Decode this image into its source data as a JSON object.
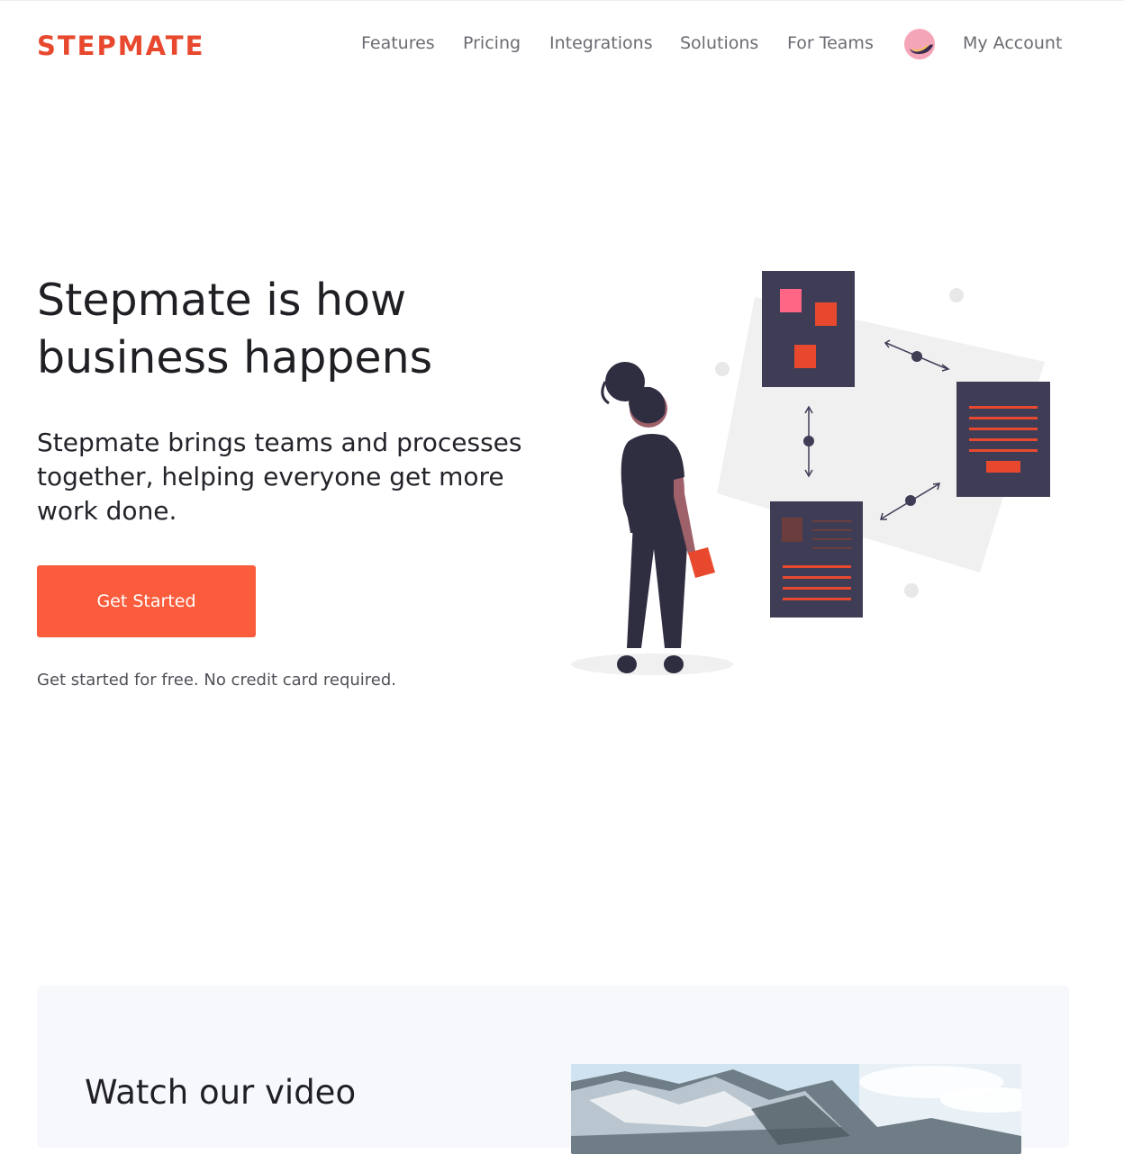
{
  "header": {
    "logo": "STEPMATE",
    "nav": [
      {
        "label": "Features"
      },
      {
        "label": "Pricing"
      },
      {
        "label": "Integrations"
      },
      {
        "label": "Solutions"
      },
      {
        "label": "For Teams"
      }
    ],
    "account_label": "My Account"
  },
  "hero": {
    "title_line1": "Stepmate is how",
    "title_line2": "business happens",
    "subtitle_line1": "Stepmate brings teams and processes",
    "subtitle_line2": "together, helping everyone get more",
    "subtitle_line3": "work done.",
    "cta_label": "Get Started",
    "note": "Get started for free. No credit card required."
  },
  "video_section": {
    "title": "Watch our video"
  },
  "colors": {
    "brand": "#e8492e",
    "cta": "#fb5c3b",
    "card_dark": "#3f3d56",
    "panel_bg": "#f6f8fc"
  }
}
